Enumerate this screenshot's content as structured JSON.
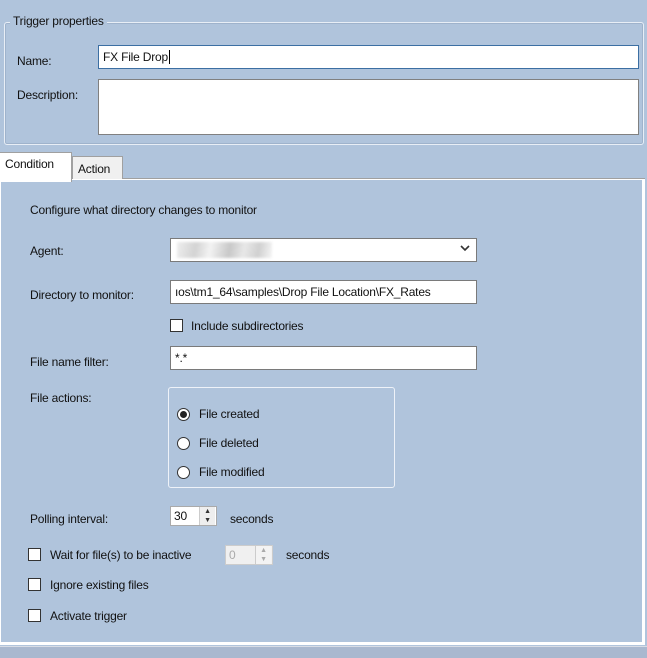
{
  "trigger_properties": {
    "legend": "Trigger properties",
    "name_label": "Name:",
    "name_value": "FX File Drop",
    "description_label": "Description:",
    "description_value": ""
  },
  "tabs": [
    {
      "label": "Condition",
      "active": true
    },
    {
      "label": "Action",
      "active": false
    }
  ],
  "condition": {
    "heading": "Configure what directory changes to monitor",
    "agent_label": "Agent:",
    "agent_value": "",
    "directory_label": "Directory to monitor:",
    "directory_value": "ıos\\tm1_64\\samples\\Drop File Location\\FX_Rates",
    "include_subdirectories_label": "Include subdirectories",
    "include_subdirectories_checked": false,
    "file_filter_label": "File name filter:",
    "file_filter_value": "*.*",
    "file_actions_label": "File actions:",
    "file_actions": [
      {
        "label": "File created",
        "checked": true
      },
      {
        "label": "File deleted",
        "checked": false
      },
      {
        "label": "File modified",
        "checked": false
      }
    ],
    "polling_label": "Polling interval:",
    "polling_value": "30",
    "polling_unit": "seconds",
    "wait_inactive_label": "Wait for file(s) to be inactive",
    "wait_inactive_checked": false,
    "wait_inactive_value": "0",
    "wait_inactive_unit": "seconds",
    "ignore_existing_label": "Ignore existing files",
    "ignore_existing_checked": false,
    "activate_label": "Activate trigger",
    "activate_checked": false
  },
  "icons": {
    "dropdown": "chevron-down-icon",
    "spin_up": "▲",
    "spin_down": "▼"
  }
}
